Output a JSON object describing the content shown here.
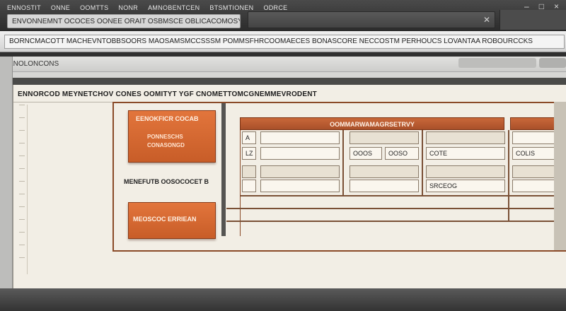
{
  "titlebar": {
    "menu": [
      "ENNOSTIT",
      "ONNE",
      "OOMTTS",
      "NONR",
      "AMNOBENTCEN",
      "BTSMTIONEN",
      "ODRCE"
    ],
    "document_title": "ENVONNEMNT OCOCES OONEE ORAIT OSBMSCE OBLICACOMOSY",
    "window_controls": [
      "–",
      "□",
      "×"
    ]
  },
  "address": {
    "text": "BORNCMACOTT MACHEVNTOBBSOORS MAOSAMSMCCSSSM POMMSFHRCOOMAECES BONASCORE NECCOSTM PERHOUCS LOVANTAA ROBOURCCKS"
  },
  "window": {
    "title": "ENOLONCONS",
    "heading": "ENNORCOD MEYNETCHOV CONES OOMITYT YGF CNOMETTOMCGNEMMEVRODENT"
  },
  "panel": {
    "button_a": {
      "title": "EENOKFICR COCAB",
      "line1": "PONNESCHS",
      "line2": "CONASONGD"
    },
    "section_label": "MENEFUTB OOSOCOCET B",
    "button_b": {
      "title": "MEOSCOC ERRIEAN"
    }
  },
  "grid": {
    "header": "OOMMARWAMAGRSETRVY",
    "cells": {
      "r1c0": "A",
      "r2c0": "LZ",
      "r2c1b": "OOOS",
      "r2c1c": "OOSO",
      "r2c2": "COTE",
      "r2c3": "COLIS",
      "r4c2": "SRCEOG"
    }
  },
  "colors": {
    "accent_orange": "#c85d28",
    "frame_brown": "#8a4a28",
    "paper": "#f2eee5"
  }
}
